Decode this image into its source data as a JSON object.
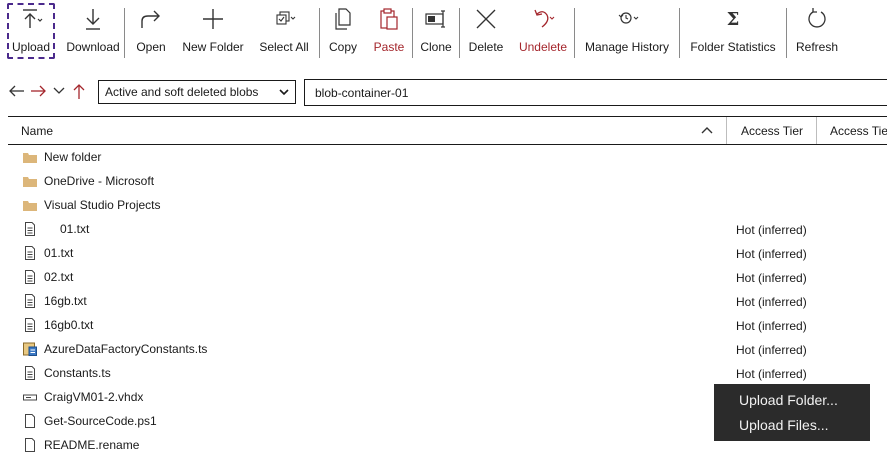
{
  "toolbar": {
    "upload": "Upload",
    "download": "Download",
    "open": "Open",
    "new_folder": "New Folder",
    "select_all": "Select All",
    "copy": "Copy",
    "paste": "Paste",
    "clone": "Clone",
    "delete": "Delete",
    "undelete": "Undelete",
    "manage_history": "Manage History",
    "folder_statistics": "Folder Statistics",
    "refresh": "Refresh"
  },
  "nav": {
    "filter_selected": "Active and soft deleted blobs",
    "path": "blob-container-01"
  },
  "grid": {
    "columns": [
      "Name",
      "Access Tier",
      "Access Tie"
    ],
    "sort_icon": "chevron-up-icon",
    "rows": [
      {
        "name": "New folder",
        "icon": "folder-icon",
        "tier": ""
      },
      {
        "name": "OneDrive - Microsoft",
        "icon": "folder-icon",
        "tier": ""
      },
      {
        "name": "Visual Studio Projects",
        "icon": "folder-icon",
        "tier": ""
      },
      {
        "name": "01.txt",
        "icon": "text-file-icon",
        "tier": "Hot (inferred)"
      },
      {
        "name": "01.txt",
        "icon": "text-file-icon",
        "tier": "Hot (inferred)"
      },
      {
        "name": "02.txt",
        "icon": "text-file-icon",
        "tier": "Hot (inferred)"
      },
      {
        "name": "16gb.txt",
        "icon": "text-file-icon",
        "tier": "Hot (inferred)"
      },
      {
        "name": "16gb0.txt",
        "icon": "text-file-icon",
        "tier": "Hot (inferred)"
      },
      {
        "name": "AzureDataFactoryConstants.ts",
        "icon": "ts-file-icon",
        "tier": "Hot (inferred)"
      },
      {
        "name": "Constants.ts",
        "icon": "text-file-icon",
        "tier": "Hot (inferred)"
      },
      {
        "name": "CraigVM01-2.vhdx",
        "icon": "disk-file-icon",
        "tier": ""
      },
      {
        "name": "Get-SourceCode.ps1",
        "icon": "blank-file-icon",
        "tier": ""
      },
      {
        "name": "README.rename",
        "icon": "blank-file-icon",
        "tier": ""
      }
    ]
  },
  "context_menu": {
    "items": [
      "Upload Folder...",
      "Upload Files..."
    ]
  },
  "colors": {
    "folder": "#dcb67a",
    "red_accent": "#a4262c",
    "menu_bg": "#2b2b2b",
    "focus_outline": "#4b2a8c"
  }
}
